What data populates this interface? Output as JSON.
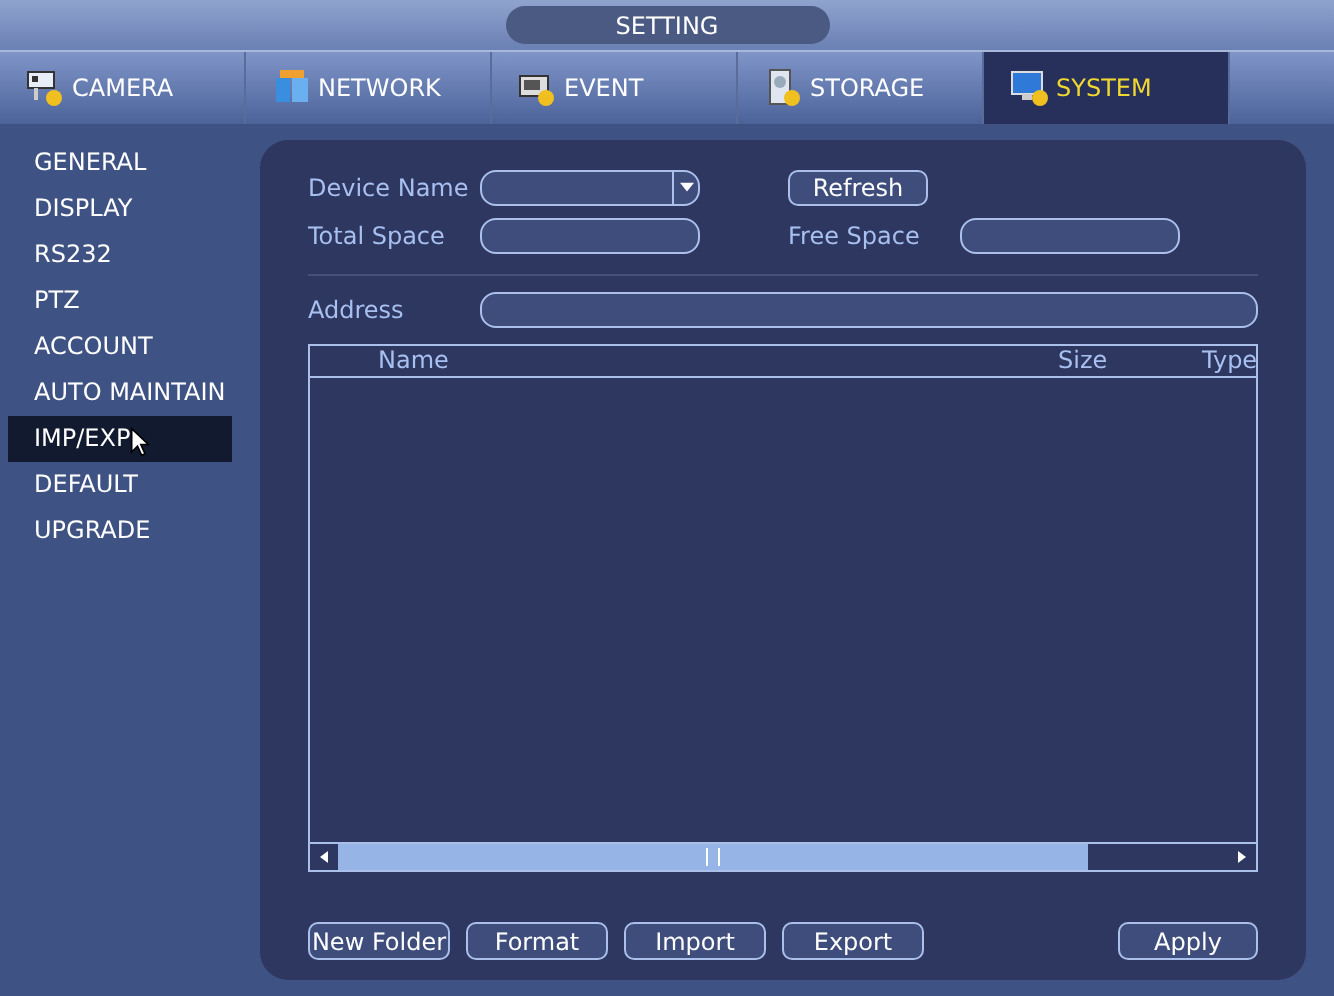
{
  "window": {
    "title": "SETTING"
  },
  "tabs": [
    {
      "label": "CAMERA",
      "selected": false
    },
    {
      "label": "NETWORK",
      "selected": false
    },
    {
      "label": "EVENT",
      "selected": false
    },
    {
      "label": "STORAGE",
      "selected": false
    },
    {
      "label": "SYSTEM",
      "selected": true
    }
  ],
  "sidebar": {
    "items": [
      {
        "label": "GENERAL",
        "selected": false
      },
      {
        "label": "DISPLAY",
        "selected": false
      },
      {
        "label": "RS232",
        "selected": false
      },
      {
        "label": "PTZ",
        "selected": false
      },
      {
        "label": "ACCOUNT",
        "selected": false
      },
      {
        "label": "AUTO MAINTAIN",
        "selected": false
      },
      {
        "label": "IMP/EXP",
        "selected": true
      },
      {
        "label": "DEFAULT",
        "selected": false
      },
      {
        "label": "UPGRADE",
        "selected": false
      }
    ]
  },
  "form": {
    "device_name": {
      "label": "Device Name"
    },
    "refresh_button": "Refresh",
    "total_space": {
      "label": "Total Space"
    },
    "free_space": {
      "label": "Free Space"
    },
    "address": {
      "label": "Address"
    }
  },
  "table": {
    "columns": [
      "Name",
      "Size",
      "Type"
    ]
  },
  "buttons": [
    "New Folder",
    "Format",
    "Import",
    "Export"
  ],
  "apply_button": "Apply"
}
